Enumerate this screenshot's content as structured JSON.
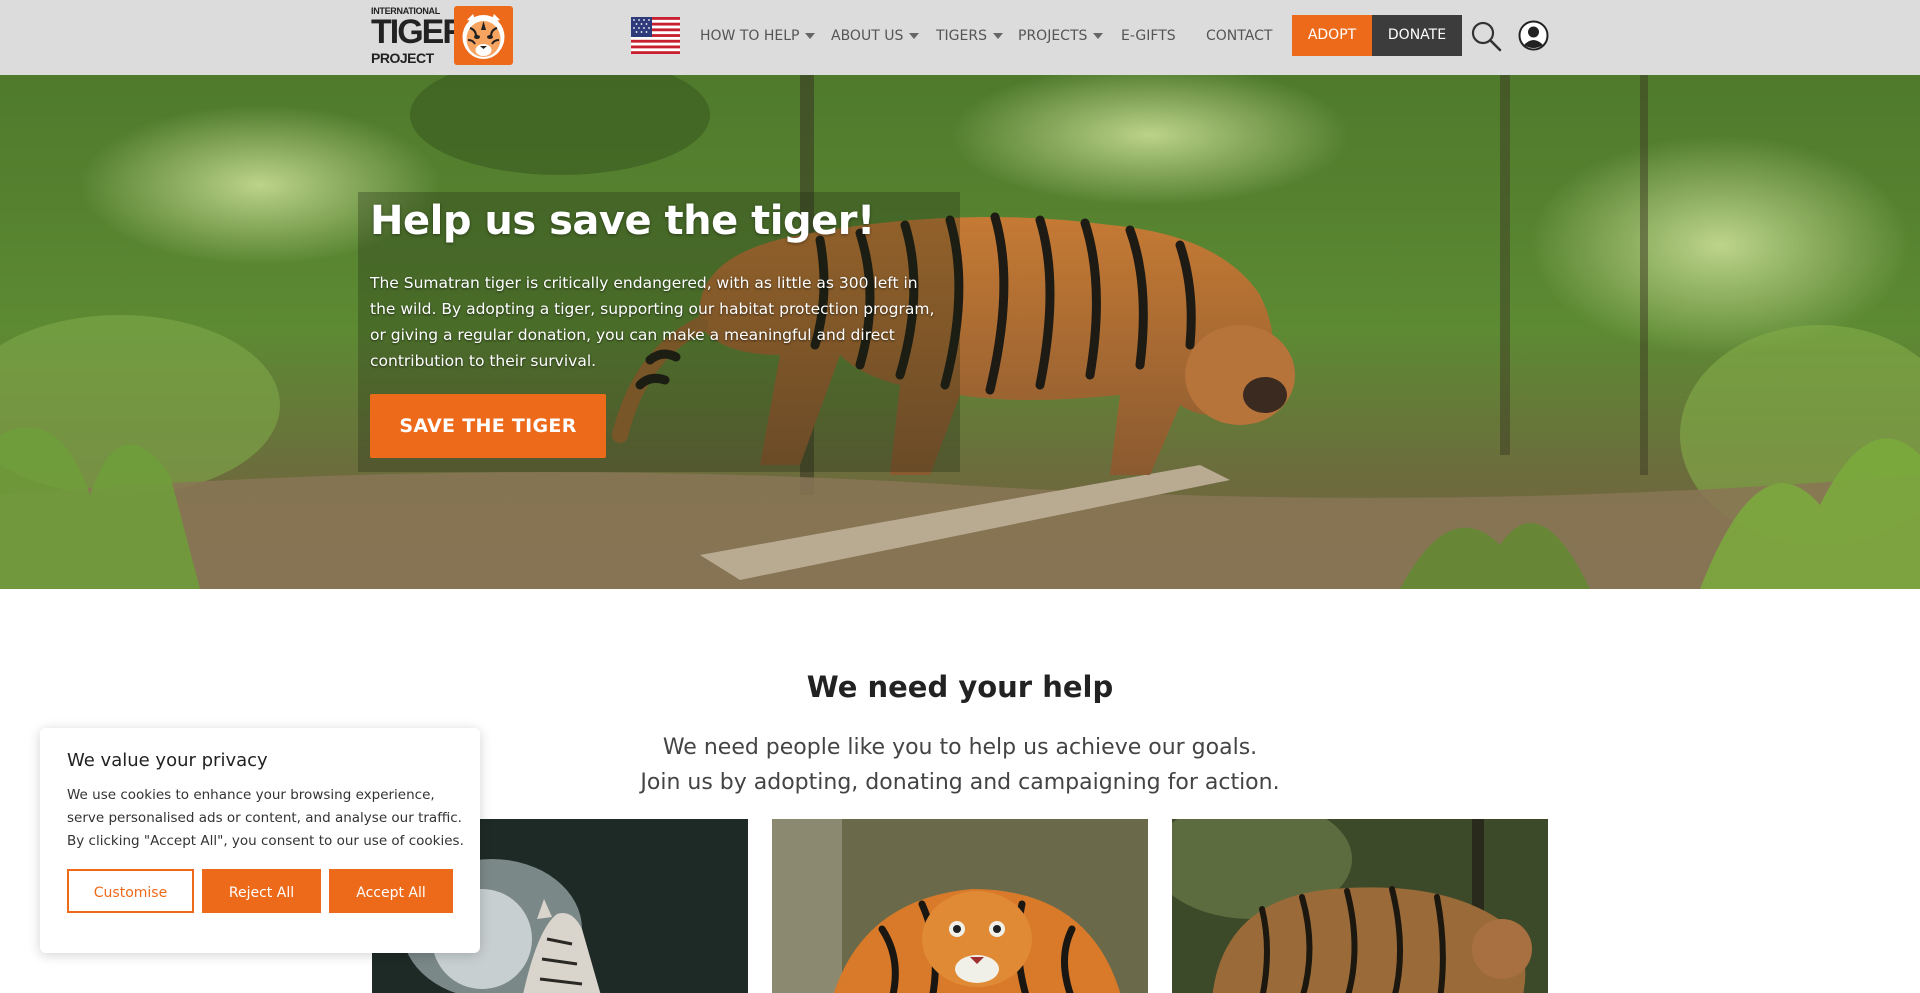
{
  "logo": {
    "line1": "INTERNATIONAL",
    "line2": "TIGER",
    "line3": "PROJECT"
  },
  "nav": {
    "flag_icon": "us-flag-icon",
    "items": [
      {
        "label": "HOW TO HELP",
        "dropdown": true
      },
      {
        "label": "ABOUT US",
        "dropdown": true
      },
      {
        "label": "TIGERS",
        "dropdown": true
      },
      {
        "label": "PROJECTS",
        "dropdown": true
      },
      {
        "label": "E-GIFTS",
        "dropdown": false
      },
      {
        "label": "CONTACT",
        "dropdown": false
      }
    ],
    "adopt_label": "ADOPT",
    "donate_label": "DONATE",
    "search_icon": "search-icon",
    "account_icon": "user-icon"
  },
  "hero": {
    "title": "Help us save the tiger!",
    "text": "The Sumatran tiger is critically endangered, with as little as 300 left in the wild. By adopting a tiger, supporting our habitat protection program, or giving a regular donation, you can make a meaningful and direct contribution to their survival.",
    "button_label": "SAVE THE TIGER"
  },
  "help": {
    "title": "We need your help",
    "line1": "We need people like you to help us achieve our goals.",
    "line2": "Join us by adopting, donating and campaigning for action."
  },
  "cookie": {
    "title": "We value your privacy",
    "text": "We use cookies to enhance your browsing experience, serve personalised ads or content, and analyse our traffic. By clicking \"Accept All\", you consent to our use of cookies.",
    "customise_label": "Customise",
    "reject_label": "Reject All",
    "accept_label": "Accept All"
  },
  "colors": {
    "accent": "#ee6a1b",
    "header_bg": "#dcdcdc",
    "donate_bg": "#3c3c3c"
  }
}
